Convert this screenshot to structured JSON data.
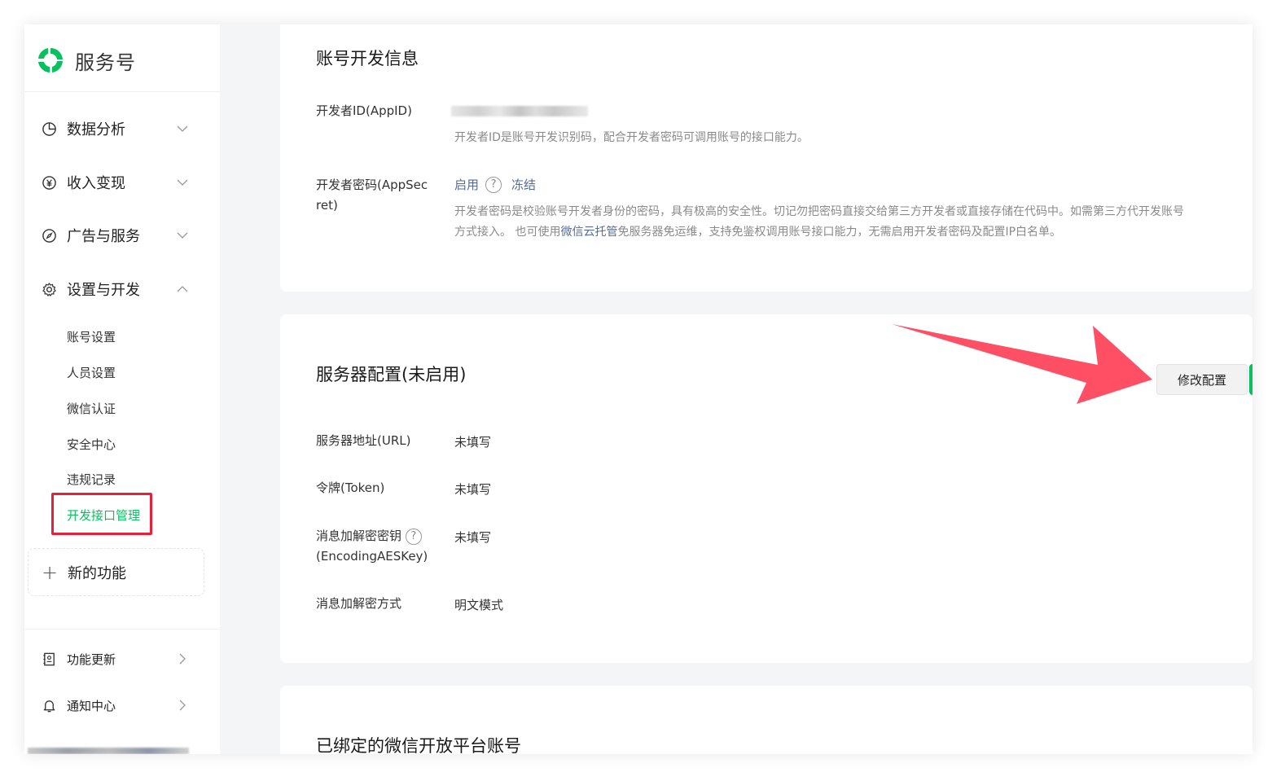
{
  "app": {
    "title": "服务号",
    "brand_color": "#07c160"
  },
  "sidebar": {
    "main_items": [
      {
        "label": "数据分析",
        "icon": "pie-chart-icon",
        "expanded": false
      },
      {
        "label": "收入变现",
        "icon": "yen-icon",
        "expanded": false
      },
      {
        "label": "广告与服务",
        "icon": "compass-icon",
        "expanded": false
      },
      {
        "label": "设置与开发",
        "icon": "gear-icon",
        "expanded": true
      }
    ],
    "sub_items": [
      {
        "label": "账号设置"
      },
      {
        "label": "人员设置"
      },
      {
        "label": "微信认证"
      },
      {
        "label": "安全中心"
      },
      {
        "label": "违规记录"
      },
      {
        "label": "开发接口管理",
        "active": true
      }
    ],
    "new_feature": "新的功能",
    "bottom_items": [
      {
        "label": "功能更新",
        "icon": "book-icon"
      },
      {
        "label": "通知中心",
        "icon": "bell-icon"
      }
    ],
    "highlight_color": "#e8213a"
  },
  "dev_info": {
    "title": "账号开发信息",
    "appid_label": "开发者ID(AppID)",
    "appid_desc": "开发者ID是账号开发识别码，配合开发者密码可调用账号的接口能力。",
    "secret_label_line1": "开发者密码(AppSec",
    "secret_label_line2": "ret)",
    "secret_enable": "启用",
    "secret_freeze": "冻结",
    "secret_desc_line1": "开发者密码是校验账号开发者身份的密码，具有极高的安全性。切记勿把密码直接交给第三方开发者或直接存储在代码中。如需第三方代开发账号",
    "secret_desc_line2_pre": "方式接入。 也可使用",
    "secret_desc_link": "微信云托管",
    "secret_desc_line2_post": "免服务器免运维，支持免鉴权调用账号接口能力，无需启用开发者密码及配置IP白名单。"
  },
  "server_config": {
    "title": "服务器配置(未启用)",
    "modify_button": "修改配置",
    "fields": [
      {
        "label": "服务器地址(URL)",
        "value": "未填写"
      },
      {
        "label": "令牌(Token)",
        "value": "未填写"
      },
      {
        "label": "消息加解密密钥",
        "label2": "(EncodingAESKey)",
        "value": "未填写"
      },
      {
        "label": "消息加解密方式",
        "value": "明文模式"
      }
    ],
    "arrow_color": "#ff4f64"
  },
  "bound_platform": {
    "title": "已绑定的微信开放平台账号"
  }
}
